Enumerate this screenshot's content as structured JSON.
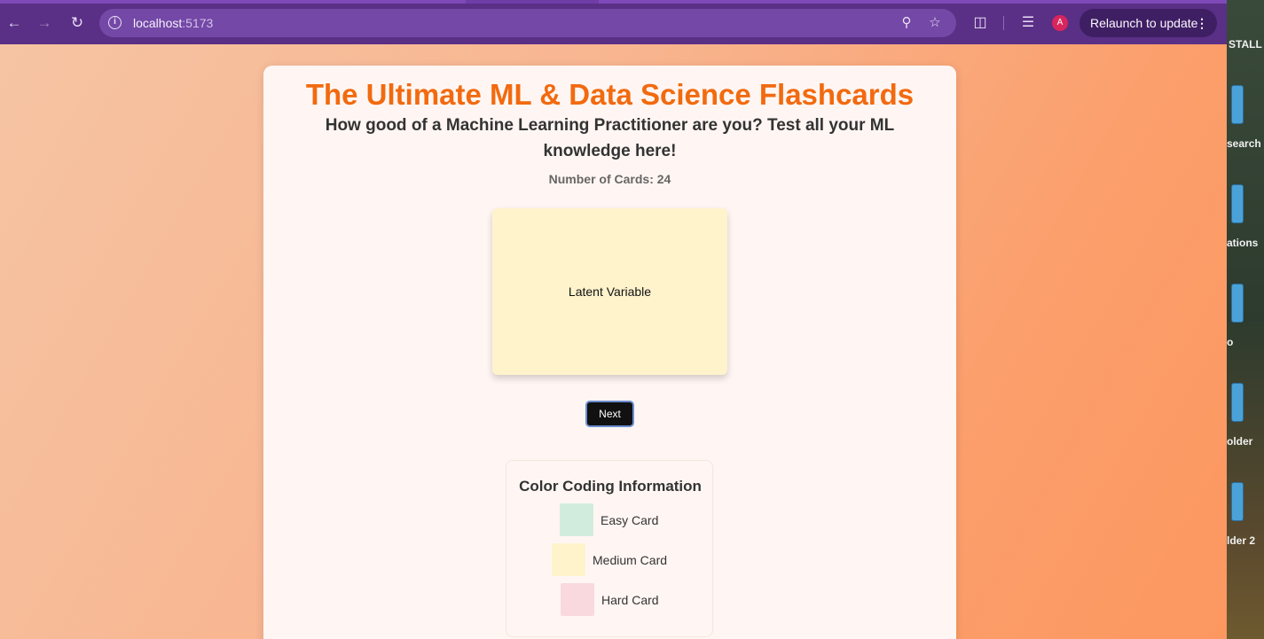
{
  "browser": {
    "url_host": "localhost",
    "url_port": ":5173",
    "relaunch_label": "Relaunch to update",
    "profile_initial": "A"
  },
  "page": {
    "title": "The Ultimate ML & Data Science Flashcards",
    "subtitle": "How good of a Machine Learning Practitioner are you? Test all your ML knowledge here!",
    "card_count_label": "Number of Cards: 24",
    "current_card": "Latent Variable",
    "next_label": "Next"
  },
  "legend": {
    "title": "Color Coding Information",
    "items": [
      {
        "label": "Easy Card",
        "color": "#d1ecdc"
      },
      {
        "label": "Medium Card",
        "color": "#fff3cc"
      },
      {
        "label": "Hard Card",
        "color": "#f9d9de"
      }
    ]
  },
  "desktop": {
    "labels": [
      "STALL",
      "search",
      "ations",
      "o",
      "older",
      "lder 2"
    ]
  }
}
